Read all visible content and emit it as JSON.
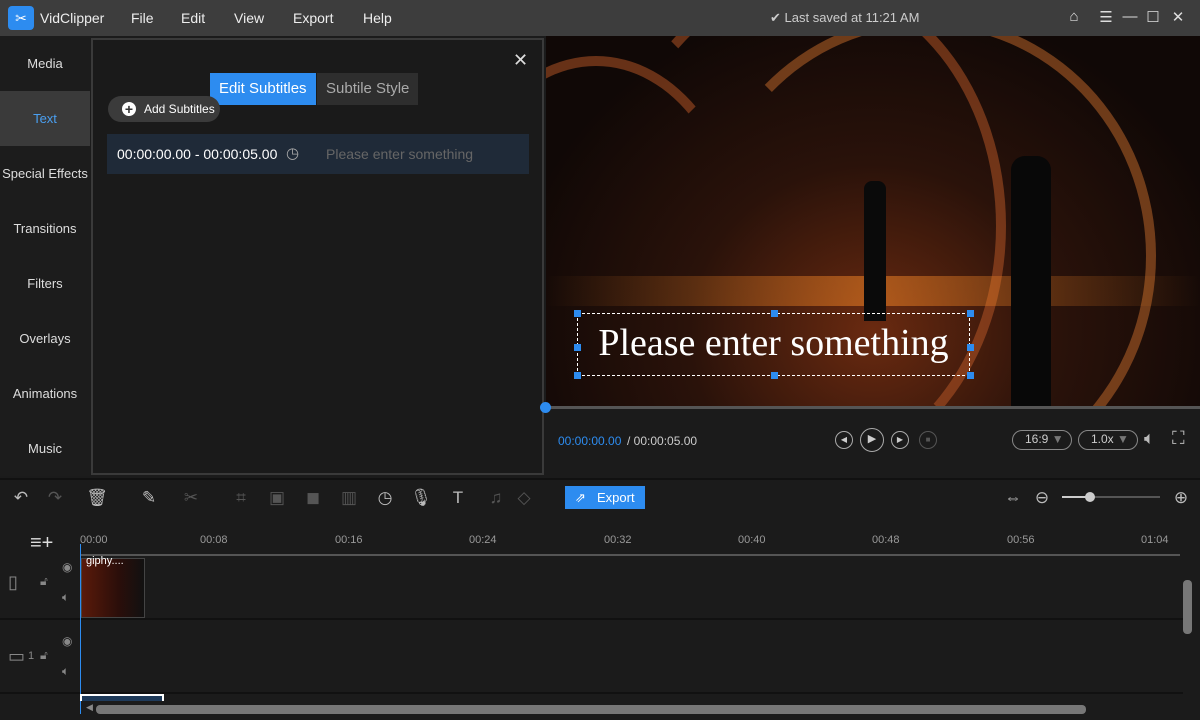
{
  "app": {
    "name": "VidClipper",
    "menu": [
      "File",
      "Edit",
      "View",
      "Export",
      "Help"
    ],
    "saved_status": "Last saved at 11:21 AM"
  },
  "sidebar": {
    "items": [
      "Media",
      "Text",
      "Special Effects",
      "Transitions",
      "Filters",
      "Overlays",
      "Animations",
      "Music"
    ],
    "selected": "Text"
  },
  "panel": {
    "tabs": [
      "Edit Subtitles",
      "Subtile Style"
    ],
    "active_tab": "Edit Subtitles",
    "add_label": "Add Subtitles",
    "subtitle": {
      "time_range": "00:00:00.00 - 00:00:05.00",
      "placeholder": "Please enter something"
    }
  },
  "preview": {
    "subtitle_text": "Please enter something",
    "current_time": "00:00:00.00",
    "total_time": "/ 00:00:05.00",
    "aspect": "16:9",
    "speed": "1.0x"
  },
  "toolbar": {
    "export_label": "Export",
    "zoom_level": 0.2
  },
  "timeline": {
    "ticks": [
      "00:00",
      "00:08",
      "00:16",
      "00:24",
      "00:32",
      "00:40",
      "00:48",
      "00:56",
      "01:04"
    ],
    "clip_name": "giphy....",
    "track2_index": "1"
  },
  "colors": {
    "accent": "#2d8cf0",
    "titlebar": "#3d3d3d"
  }
}
